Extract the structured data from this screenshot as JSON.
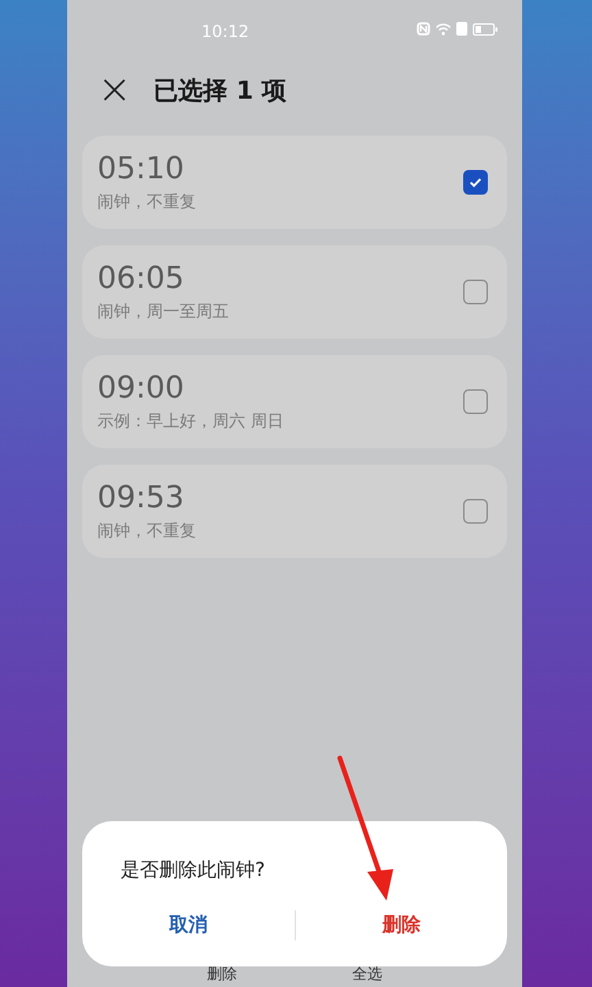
{
  "status_bar": {
    "time": "10:12"
  },
  "header": {
    "close": "×",
    "title": "已选择 1 项"
  },
  "alarms": [
    {
      "time": "05:10",
      "label": "闹钟，不重复",
      "checked": true
    },
    {
      "time": "06:05",
      "label": "闹钟，周一至周五",
      "checked": false
    },
    {
      "time": "09:00",
      "label": "示例：早上好，周六 周日",
      "checked": false
    },
    {
      "time": "09:53",
      "label": "闹钟，不重复",
      "checked": false
    }
  ],
  "bottom_bar": [
    "删除",
    "全选"
  ],
  "dialog": {
    "message": "是否删除此闹钟?",
    "buttons": [
      {
        "label": "取消",
        "kind": "cancel"
      },
      {
        "label": "删除",
        "kind": "danger"
      }
    ]
  }
}
